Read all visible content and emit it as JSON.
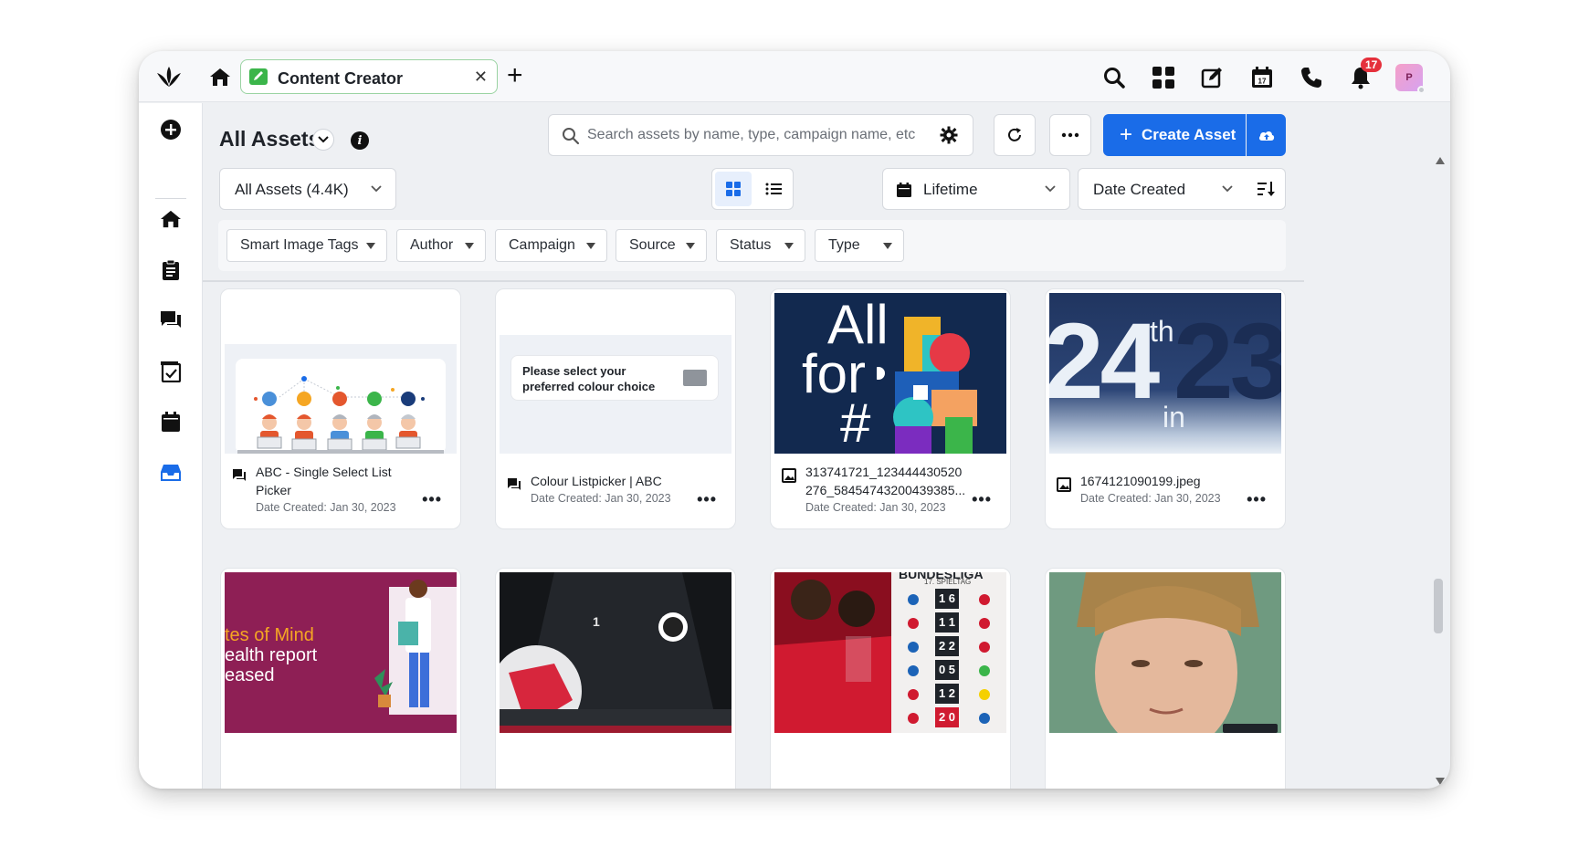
{
  "topbar": {
    "tab_label": "Content Creator",
    "notification_count": "17",
    "avatar_initial": "P"
  },
  "header": {
    "title": "All Assets"
  },
  "search": {
    "placeholder": "Search assets by name, type, campaign name, etc"
  },
  "actions": {
    "create_label": "Create Asset"
  },
  "filters_row": {
    "asset_scope": "All Assets (4.4K)",
    "date_range": "Lifetime",
    "sort_by": "Date Created"
  },
  "filter_chips": [
    {
      "label": "Smart Image Tags"
    },
    {
      "label": "Author"
    },
    {
      "label": "Campaign"
    },
    {
      "label": "Source"
    },
    {
      "label": "Status"
    },
    {
      "label": "Type"
    }
  ],
  "cards": [
    {
      "title_line1": "ABC - Single Select List",
      "title_line2": "Picker",
      "date": "Date Created: Jan 30, 2023"
    },
    {
      "title_line1": "Colour Listpicker | ABC",
      "title_line2": "",
      "date": "Date Created: Jan 30, 2023",
      "thumb_text_line1": "Please select your",
      "thumb_text_line2": "preferred colour choice"
    },
    {
      "title_line1": "313741721_123444430520",
      "title_line2": "276_58454743200439385...",
      "date": "Date Created: Jan 30, 2023",
      "thumb_text_line1": "All",
      "thumb_text_line2": "for",
      "thumb_text_line3": "#"
    },
    {
      "title_line1": "1674121090199.jpeg",
      "title_line2": "",
      "date": "Date Created: Jan 30, 2023",
      "thumb_text_line1": "24",
      "thumb_text_line2": "th",
      "thumb_text_line3": "23",
      "thumb_text_line4": "in"
    }
  ],
  "row2_cards": [
    {
      "thumb_text_line1": "tes of Mind",
      "thumb_text_line2": "ealth report",
      "thumb_text_line3": "eased"
    },
    {
      "thumb_text_line1": "1"
    },
    {
      "thumb_text_line1": "BUNDESLIGA",
      "thumb_text_line2": "17. SPIELTAG",
      "scores": [
        "1 6",
        "1 1",
        "2 2",
        "0 5",
        "1 2",
        "2 0"
      ]
    },
    {}
  ],
  "colors": {
    "accent": "#1a6ce8",
    "tab_border": "#9ad3a2",
    "badge": "#e5303c"
  }
}
